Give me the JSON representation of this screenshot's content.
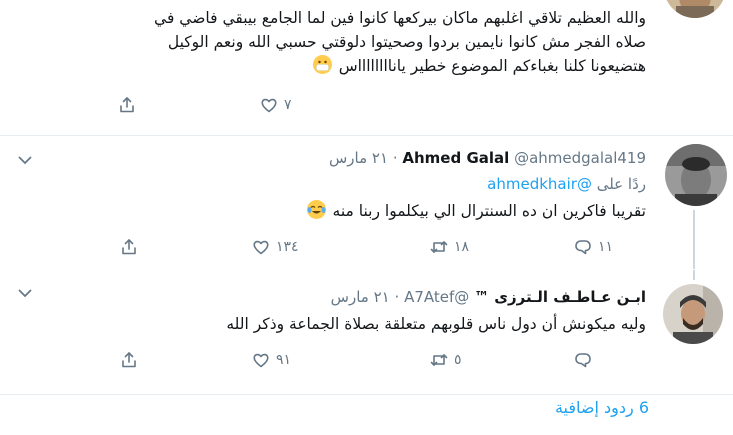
{
  "tweets": [
    {
      "text_lines": [
        "والله العظيم تلاقي اغلبهم ماكان بيركعها كانوا فين لما الجامع بيبقي فاضي في",
        "صلاه الفجر مش كانوا نايمين بردوا وصحيتوا دلوقتي حسبي الله ونعم الوكيل",
        "هتضيعونا كلنا بغباءكم الموضوع خطير يانااااااااس"
      ],
      "emoji": "face-with-medical-mask",
      "reply_count": "",
      "retweet_count": "",
      "like_count": "٧"
    },
    {
      "name": "Ahmed Galal",
      "handle": "@ahmedgalal419",
      "date": "٢١ مارس",
      "separator": "·",
      "replying_prefix": "ردًا على",
      "replying_handle": "@ahmedkhair",
      "text": "تقريبا فاكرين ان ده السنترال الي بيكلموا ربنا منه",
      "emoji": "face-with-tears-of-joy",
      "reply_count": "١١",
      "retweet_count": "١٨",
      "like_count": "١٣٤"
    },
    {
      "name": "ابـن عـاطـف الـترزى ™",
      "handle": "@A7Atef",
      "date": "٢١ مارس",
      "separator": "·",
      "text": "وليه ميكونش أن دول ناس قلوبهم متعلقة بصلاة الجماعة وذكر الله",
      "reply_count": "",
      "retweet_count": "٥",
      "like_count": "٩١"
    }
  ],
  "more_replies": "6 ردود إضافية",
  "colors": {
    "accent": "#1da1f2",
    "muted": "#657786",
    "divider": "#e6ecf0"
  }
}
